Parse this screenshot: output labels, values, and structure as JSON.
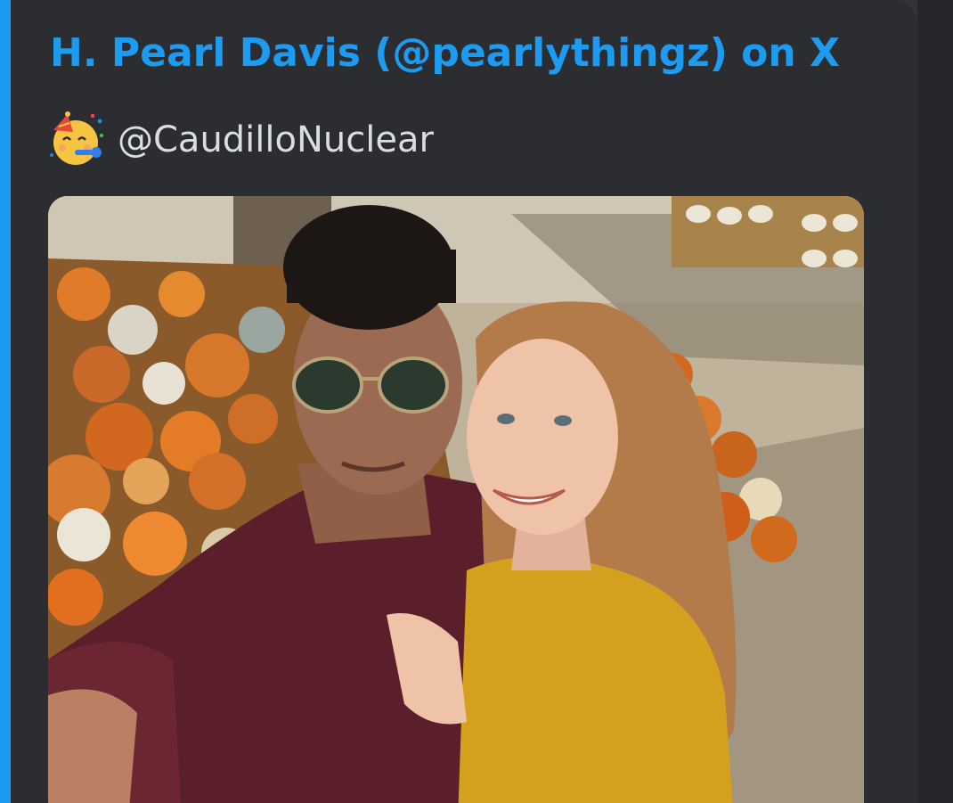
{
  "embed": {
    "title": "H. Pearl Davis (@pearlythingz) on X",
    "accent_color": "#1d9bf0",
    "author": {
      "icon": "party-face-emoji-icon",
      "handle": "@CaudilloNuclear"
    },
    "image": {
      "icon": "photo-attachment"
    }
  }
}
